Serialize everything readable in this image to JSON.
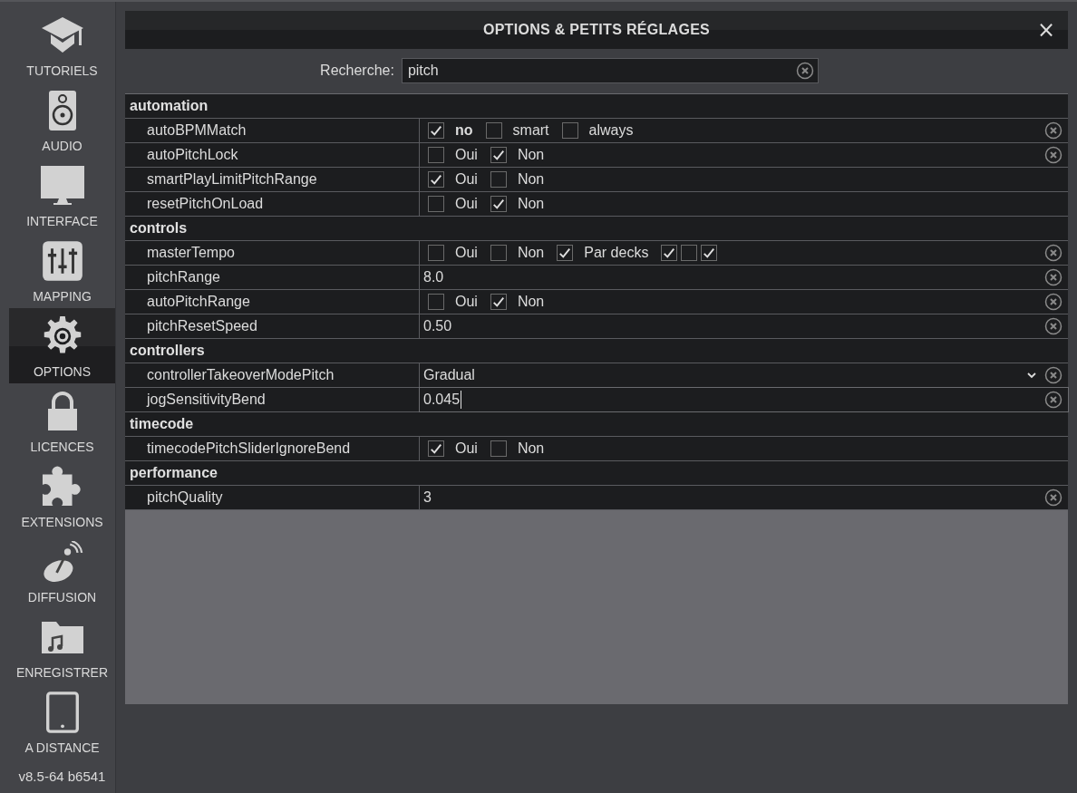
{
  "sidebar": {
    "items": [
      {
        "label": "TUTORIELS",
        "selected": false
      },
      {
        "label": "AUDIO",
        "selected": false
      },
      {
        "label": "INTERFACE",
        "selected": false
      },
      {
        "label": "MAPPING",
        "selected": false
      },
      {
        "label": "OPTIONS",
        "selected": true
      },
      {
        "label": "LICENCES",
        "selected": false
      },
      {
        "label": "EXTENSIONS",
        "selected": false
      },
      {
        "label": "DIFFUSION",
        "selected": false
      },
      {
        "label": "ENREGISTRER",
        "selected": false
      },
      {
        "label": "A DISTANCE",
        "selected": false
      }
    ],
    "version": "v8.5-64 b6541"
  },
  "dialog": {
    "title": "OPTIONS & PETITS RÉGLAGES",
    "close": "×"
  },
  "search": {
    "label": "Recherche:",
    "value": "pitch"
  },
  "sections": [
    {
      "title": "automation",
      "settings": [
        {
          "name": "autoBPMMatch",
          "kind": "checks",
          "clearable": true,
          "options": [
            {
              "label": "no",
              "checked": true,
              "bold": true
            },
            {
              "label": "smart",
              "checked": false,
              "bold": false
            },
            {
              "label": "always",
              "checked": false,
              "bold": false
            }
          ]
        },
        {
          "name": "autoPitchLock",
          "kind": "checks",
          "clearable": true,
          "options": [
            {
              "label": "Oui",
              "checked": false
            },
            {
              "label": "Non",
              "checked": true
            }
          ]
        },
        {
          "name": "smartPlayLimitPitchRange",
          "kind": "checks",
          "clearable": false,
          "options": [
            {
              "label": "Oui",
              "checked": true
            },
            {
              "label": "Non",
              "checked": false
            }
          ]
        },
        {
          "name": "resetPitchOnLoad",
          "kind": "checks",
          "clearable": false,
          "options": [
            {
              "label": "Oui",
              "checked": false
            },
            {
              "label": "Non",
              "checked": true
            }
          ]
        }
      ]
    },
    {
      "title": "controls",
      "settings": [
        {
          "name": "masterTempo",
          "kind": "checks",
          "clearable": true,
          "options": [
            {
              "label": "Oui",
              "checked": false
            },
            {
              "label": "Non",
              "checked": false
            },
            {
              "label": "Par decks",
              "checked": true
            },
            {
              "checked": true
            },
            {
              "checked": false
            },
            {
              "checked": true
            }
          ]
        },
        {
          "name": "pitchRange",
          "kind": "value",
          "clearable": true,
          "value": "8.0",
          "focused": false
        },
        {
          "name": "autoPitchRange",
          "kind": "checks",
          "clearable": true,
          "options": [
            {
              "label": "Oui",
              "checked": false
            },
            {
              "label": "Non",
              "checked": true
            }
          ]
        },
        {
          "name": "pitchResetSpeed",
          "kind": "value",
          "clearable": true,
          "value": "0.50",
          "focused": false
        }
      ]
    },
    {
      "title": "controllers",
      "settings": [
        {
          "name": "controllerTakeoverModePitch",
          "kind": "select",
          "clearable": true,
          "value": "Gradual"
        },
        {
          "name": "jogSensitivityBend",
          "kind": "value",
          "clearable": true,
          "value": "0.045",
          "focused": true
        }
      ]
    },
    {
      "title": "timecode",
      "settings": [
        {
          "name": "timecodePitchSliderIgnoreBend",
          "kind": "checks",
          "clearable": false,
          "options": [
            {
              "label": "Oui",
              "checked": true
            },
            {
              "label": "Non",
              "checked": false
            }
          ]
        }
      ]
    },
    {
      "title": "performance",
      "settings": [
        {
          "name": "pitchQuality",
          "kind": "value",
          "clearable": true,
          "value": "3",
          "focused": false
        }
      ]
    }
  ]
}
